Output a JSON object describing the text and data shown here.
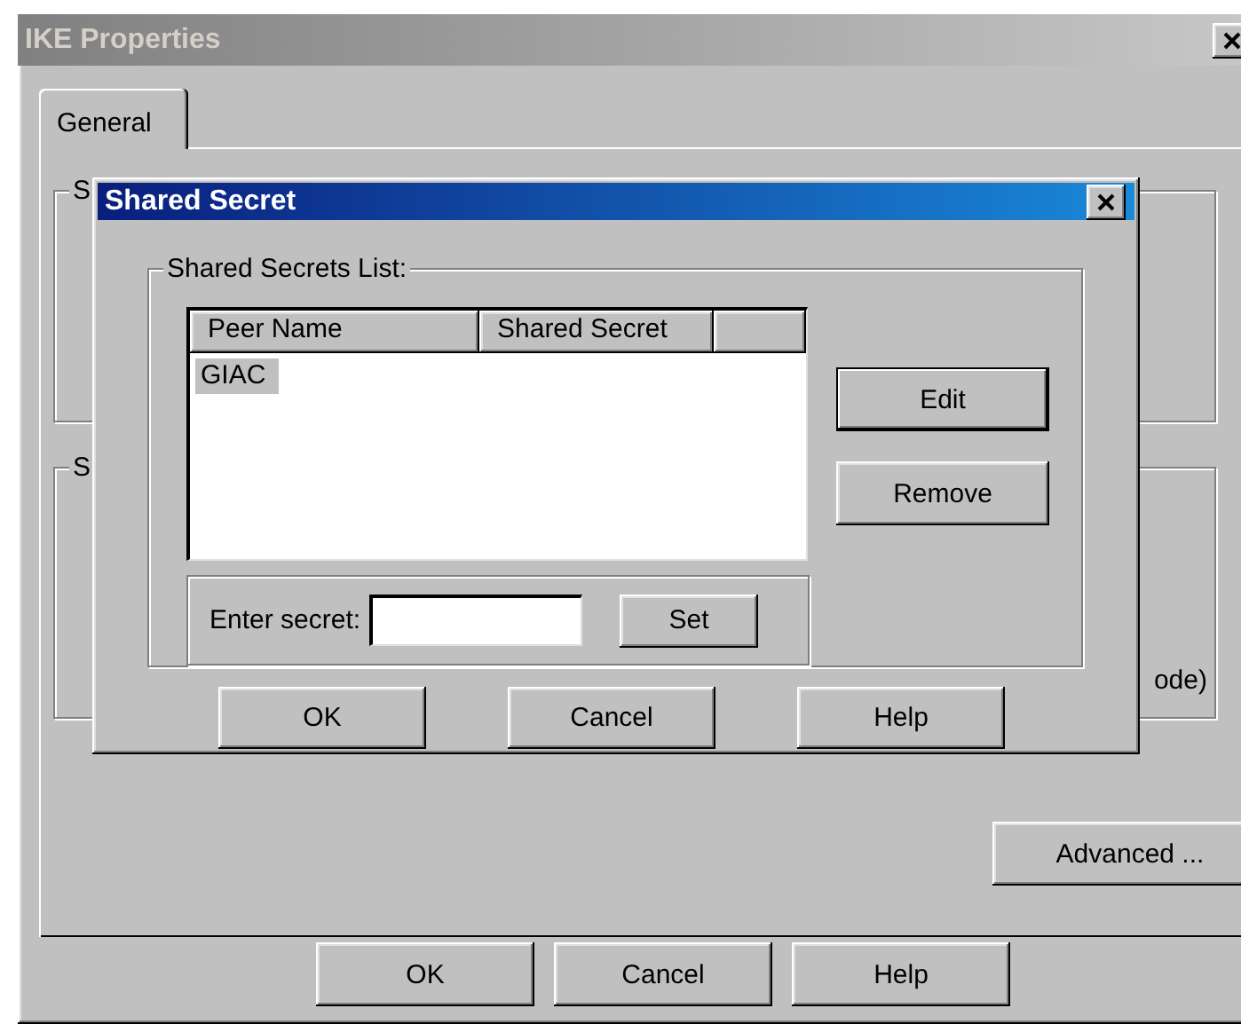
{
  "window": {
    "title": "IKE Properties",
    "active": false
  },
  "tabs": [
    {
      "label": "General",
      "selected": true
    }
  ],
  "groups": [
    {
      "label": "S"
    },
    {
      "label": "S",
      "trailing_text": "ode)"
    }
  ],
  "advanced_button": "Advanced ...",
  "buttons": [
    "OK",
    "Cancel",
    "Help"
  ],
  "dialog": {
    "title": "Shared Secret",
    "active": true,
    "group_label": "Shared Secrets List:",
    "columns": [
      "Peer Name",
      "Shared Secret"
    ],
    "rows": [
      {
        "cells": [
          "GIAC"
        ],
        "selected": true
      }
    ],
    "secret_label": "Enter secret:",
    "set_button": "Set",
    "side_buttons": [
      {
        "label": "Edit",
        "default": true
      },
      {
        "label": "Remove",
        "default": false
      }
    ],
    "buttons": [
      "OK",
      "Cancel",
      "Help"
    ]
  }
}
